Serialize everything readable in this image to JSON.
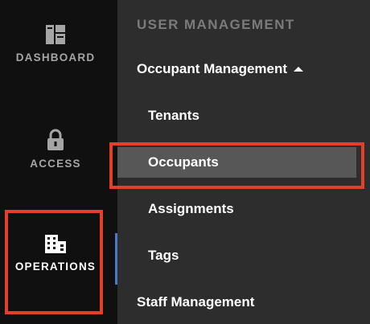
{
  "rail": {
    "items": [
      {
        "label": "DASHBOARD",
        "icon": "dashboard-icon"
      },
      {
        "label": "ACCESS",
        "icon": "lock-icon"
      },
      {
        "label": "OPERATIONS",
        "icon": "building-icon",
        "active": true
      }
    ]
  },
  "panel": {
    "section_header": "USER MANAGEMENT",
    "occupant_group": {
      "label": "Occupant Management",
      "expanded": true,
      "items": [
        {
          "label": "Tenants"
        },
        {
          "label": "Occupants",
          "selected": true
        },
        {
          "label": "Assignments"
        },
        {
          "label": "Tags"
        }
      ]
    },
    "staff_group": {
      "label": "Staff Management"
    }
  },
  "colors": {
    "accent_blue": "#4a79c9",
    "highlight_red": "#e3402b",
    "selected_bg": "#575757"
  }
}
